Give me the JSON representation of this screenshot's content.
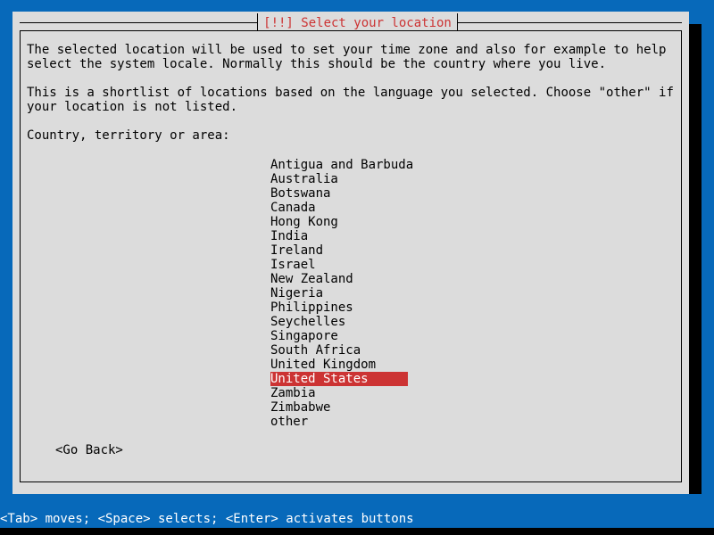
{
  "window": {
    "title": "[!!] Select your location",
    "background_color": "#0769ba",
    "dialog_color": "#dcdcdc",
    "title_color": "#cc3333",
    "highlight_color": "#cc3333"
  },
  "content": {
    "paragraph1_line1": "The selected location will be used to set your time zone and also for example to help",
    "paragraph1_line2": "select the system locale. Normally this should be the country where you live.",
    "paragraph2_line1": "This is a shortlist of locations based on the language you selected. Choose \"other\" if",
    "paragraph2_line2": "your location is not listed.",
    "list_label": "Country, territory or area:"
  },
  "country_list": {
    "selected": "United States",
    "items": [
      "Antigua and Barbuda",
      "Australia",
      "Botswana",
      "Canada",
      "Hong Kong",
      "India",
      "Ireland",
      "Israel",
      "New Zealand",
      "Nigeria",
      "Philippines",
      "Seychelles",
      "Singapore",
      "South Africa",
      "United Kingdom",
      "United States",
      "Zambia",
      "Zimbabwe",
      "other"
    ]
  },
  "buttons": {
    "go_back": "<Go Back>"
  },
  "status_bar": {
    "text": "<Tab> moves; <Space> selects; <Enter> activates buttons"
  }
}
